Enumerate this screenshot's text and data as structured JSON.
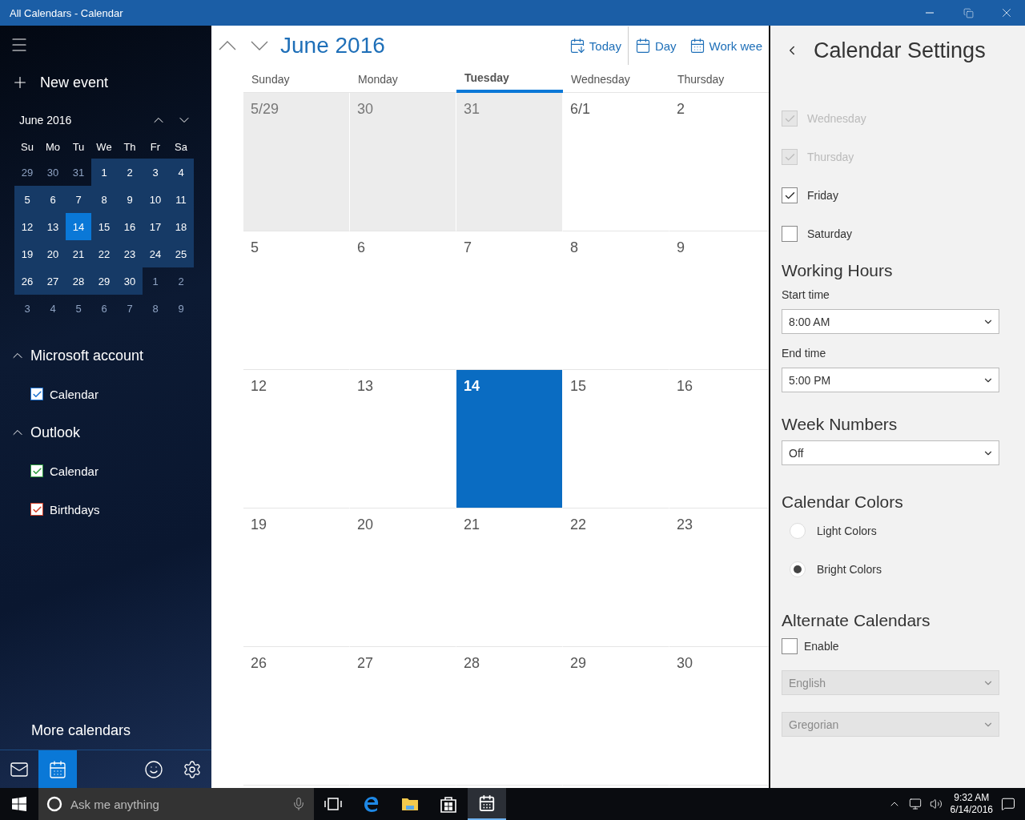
{
  "window": {
    "title": "All Calendars - Calendar"
  },
  "sidebar": {
    "new_event": "New event",
    "mini_calendar": {
      "month": "June 2016",
      "weekdays": [
        "Su",
        "Mo",
        "Tu",
        "We",
        "Th",
        "Fr",
        "Sa"
      ],
      "days": [
        {
          "label": "29",
          "in_month": false,
          "selected": false
        },
        {
          "label": "30",
          "in_month": false,
          "selected": false
        },
        {
          "label": "31",
          "in_month": false,
          "selected": false
        },
        {
          "label": "1",
          "in_month": true,
          "selected": false
        },
        {
          "label": "2",
          "in_month": true,
          "selected": false
        },
        {
          "label": "3",
          "in_month": true,
          "selected": false
        },
        {
          "label": "4",
          "in_month": true,
          "selected": false
        },
        {
          "label": "5",
          "in_month": true,
          "selected": false
        },
        {
          "label": "6",
          "in_month": true,
          "selected": false
        },
        {
          "label": "7",
          "in_month": true,
          "selected": false
        },
        {
          "label": "8",
          "in_month": true,
          "selected": false
        },
        {
          "label": "9",
          "in_month": true,
          "selected": false
        },
        {
          "label": "10",
          "in_month": true,
          "selected": false
        },
        {
          "label": "11",
          "in_month": true,
          "selected": false
        },
        {
          "label": "12",
          "in_month": true,
          "selected": false
        },
        {
          "label": "13",
          "in_month": true,
          "selected": false
        },
        {
          "label": "14",
          "in_month": true,
          "selected": true
        },
        {
          "label": "15",
          "in_month": true,
          "selected": false
        },
        {
          "label": "16",
          "in_month": true,
          "selected": false
        },
        {
          "label": "17",
          "in_month": true,
          "selected": false
        },
        {
          "label": "18",
          "in_month": true,
          "selected": false
        },
        {
          "label": "19",
          "in_month": true,
          "selected": false
        },
        {
          "label": "20",
          "in_month": true,
          "selected": false
        },
        {
          "label": "21",
          "in_month": true,
          "selected": false
        },
        {
          "label": "22",
          "in_month": true,
          "selected": false
        },
        {
          "label": "23",
          "in_month": true,
          "selected": false
        },
        {
          "label": "24",
          "in_month": true,
          "selected": false
        },
        {
          "label": "25",
          "in_month": true,
          "selected": false
        },
        {
          "label": "26",
          "in_month": true,
          "selected": false
        },
        {
          "label": "27",
          "in_month": true,
          "selected": false
        },
        {
          "label": "28",
          "in_month": true,
          "selected": false
        },
        {
          "label": "29",
          "in_month": true,
          "selected": false
        },
        {
          "label": "30",
          "in_month": true,
          "selected": false
        },
        {
          "label": "1",
          "in_month": false,
          "selected": false
        },
        {
          "label": "2",
          "in_month": false,
          "selected": false
        },
        {
          "label": "3",
          "in_month": false,
          "selected": false
        },
        {
          "label": "4",
          "in_month": false,
          "selected": false
        },
        {
          "label": "5",
          "in_month": false,
          "selected": false
        },
        {
          "label": "6",
          "in_month": false,
          "selected": false
        },
        {
          "label": "7",
          "in_month": false,
          "selected": false
        },
        {
          "label": "8",
          "in_month": false,
          "selected": false
        },
        {
          "label": "9",
          "in_month": false,
          "selected": false
        }
      ]
    },
    "accounts": [
      {
        "name": "Microsoft account",
        "expanded": true,
        "calendars": [
          {
            "name": "Calendar",
            "checked": true,
            "color": "#1e73d2"
          }
        ]
      },
      {
        "name": "Outlook",
        "expanded": true,
        "calendars": [
          {
            "name": "Calendar",
            "checked": true,
            "color": "#2e9e3e"
          },
          {
            "name": "Birthdays",
            "checked": true,
            "color": "#d4402a"
          }
        ]
      }
    ],
    "more_calendars": "More calendars",
    "nav": [
      {
        "kind": "mail",
        "selected": false
      },
      {
        "kind": "calendar",
        "selected": true
      },
      {
        "kind": "feedback",
        "selected": false
      },
      {
        "kind": "settings",
        "selected": false
      }
    ]
  },
  "main": {
    "title": "June 2016",
    "views": [
      {
        "kind": "today",
        "label": "Today"
      },
      {
        "kind": "day",
        "label": "Day"
      },
      {
        "kind": "workweek",
        "label": "Work wee"
      }
    ],
    "day_headers": [
      {
        "label": "Sunday",
        "selected": false
      },
      {
        "label": "Monday",
        "selected": false
      },
      {
        "label": "Tuesday",
        "selected": true
      },
      {
        "label": "Wednesday",
        "selected": false
      },
      {
        "label": "Thursday",
        "selected": false
      }
    ],
    "weeks": [
      [
        {
          "label": "5/29",
          "in_month": false,
          "today": false
        },
        {
          "label": "30",
          "in_month": false,
          "today": false
        },
        {
          "label": "31",
          "in_month": false,
          "today": false
        },
        {
          "label": "6/1",
          "in_month": true,
          "today": false
        },
        {
          "label": "2",
          "in_month": true,
          "today": false
        }
      ],
      [
        {
          "label": "5",
          "in_month": true,
          "today": false
        },
        {
          "label": "6",
          "in_month": true,
          "today": false
        },
        {
          "label": "7",
          "in_month": true,
          "today": false
        },
        {
          "label": "8",
          "in_month": true,
          "today": false
        },
        {
          "label": "9",
          "in_month": true,
          "today": false
        }
      ],
      [
        {
          "label": "12",
          "in_month": true,
          "today": false
        },
        {
          "label": "13",
          "in_month": true,
          "today": false
        },
        {
          "label": "14",
          "in_month": true,
          "today": true
        },
        {
          "label": "15",
          "in_month": true,
          "today": false
        },
        {
          "label": "16",
          "in_month": true,
          "today": false
        }
      ],
      [
        {
          "label": "19",
          "in_month": true,
          "today": false
        },
        {
          "label": "20",
          "in_month": true,
          "today": false
        },
        {
          "label": "21",
          "in_month": true,
          "today": false
        },
        {
          "label": "22",
          "in_month": true,
          "today": false
        },
        {
          "label": "23",
          "in_month": true,
          "today": false
        }
      ],
      [
        {
          "label": "26",
          "in_month": true,
          "today": false
        },
        {
          "label": "27",
          "in_month": true,
          "today": false
        },
        {
          "label": "28",
          "in_month": true,
          "today": false
        },
        {
          "label": "29",
          "in_month": true,
          "today": false
        },
        {
          "label": "30",
          "in_month": true,
          "today": false
        }
      ]
    ]
  },
  "settings": {
    "title": "Calendar Settings",
    "work_days": [
      {
        "label": "Wednesday",
        "checked": true,
        "disabled": true
      },
      {
        "label": "Thursday",
        "checked": true,
        "disabled": true
      },
      {
        "label": "Friday",
        "checked": true,
        "disabled": false
      },
      {
        "label": "Saturday",
        "checked": false,
        "disabled": false
      }
    ],
    "working_hours": {
      "heading": "Working Hours",
      "start_label": "Start time",
      "start_value": "8:00 AM",
      "end_label": "End time",
      "end_value": "5:00 PM"
    },
    "week_numbers": {
      "heading": "Week Numbers",
      "value": "Off"
    },
    "calendar_colors": {
      "heading": "Calendar Colors",
      "options": [
        {
          "label": "Light Colors",
          "selected": false
        },
        {
          "label": "Bright Colors",
          "selected": true
        }
      ]
    },
    "alternate_calendars": {
      "heading": "Alternate Calendars",
      "enable": {
        "label": "Enable",
        "checked": false
      },
      "language": {
        "value": "English",
        "disabled": true
      },
      "system": {
        "value": "Gregorian",
        "disabled": true
      }
    }
  },
  "taskbar": {
    "search_placeholder": "Ask me anything",
    "apps": [
      {
        "kind": "taskview",
        "selected": false
      },
      {
        "kind": "browser",
        "selected": false
      },
      {
        "kind": "folder",
        "selected": false
      },
      {
        "kind": "store",
        "selected": false
      },
      {
        "kind": "calendar",
        "selected": true
      }
    ],
    "time": "9:32 AM",
    "date": "6/14/2016"
  }
}
